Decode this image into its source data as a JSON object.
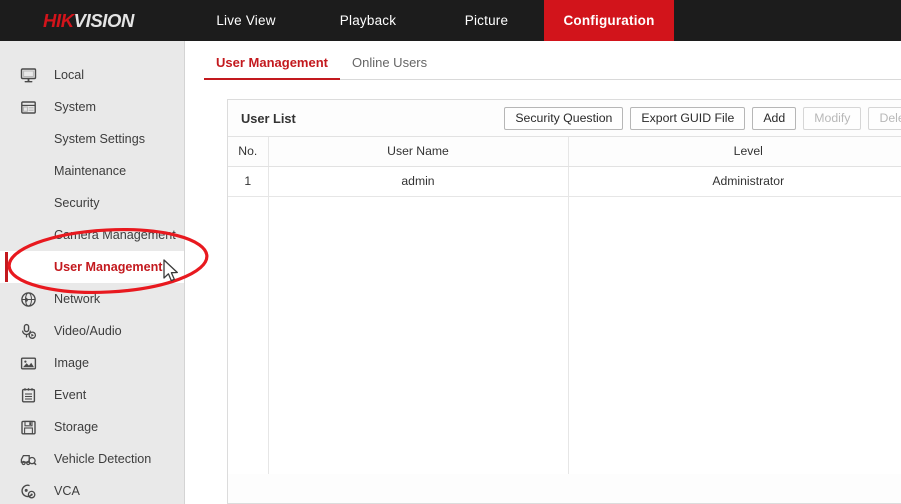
{
  "brand": {
    "name_part1": "HIK",
    "name_part2": "VISION",
    "accent": "#d2141b"
  },
  "topnav": {
    "items": [
      {
        "label": "Live View",
        "active": false
      },
      {
        "label": "Playback",
        "active": false
      },
      {
        "label": "Picture",
        "active": false
      },
      {
        "label": "Configuration",
        "active": true
      }
    ]
  },
  "sidebar": {
    "items": [
      {
        "label": "Local",
        "icon": "monitor-icon",
        "type": "parent",
        "selected": false
      },
      {
        "label": "System",
        "icon": "system-icon",
        "type": "parent",
        "selected": false
      },
      {
        "label": "System Settings",
        "icon": "",
        "type": "child",
        "selected": false
      },
      {
        "label": "Maintenance",
        "icon": "",
        "type": "child",
        "selected": false
      },
      {
        "label": "Security",
        "icon": "",
        "type": "child",
        "selected": false
      },
      {
        "label": "Camera Management",
        "icon": "",
        "type": "child",
        "selected": false
      },
      {
        "label": "User Management",
        "icon": "",
        "type": "child",
        "selected": true
      },
      {
        "label": "Network",
        "icon": "globe-icon",
        "type": "parent",
        "selected": false
      },
      {
        "label": "Video/Audio",
        "icon": "microphone-icon",
        "type": "parent",
        "selected": false
      },
      {
        "label": "Image",
        "icon": "picture-icon",
        "type": "parent",
        "selected": false
      },
      {
        "label": "Event",
        "icon": "clipboard-icon",
        "type": "parent",
        "selected": false
      },
      {
        "label": "Storage",
        "icon": "floppy-disk-icon",
        "type": "parent",
        "selected": false
      },
      {
        "label": "Vehicle Detection",
        "icon": "vehicle-search-icon",
        "type": "parent",
        "selected": false
      },
      {
        "label": "VCA",
        "icon": "vca-icon",
        "type": "parent",
        "selected": false
      }
    ]
  },
  "content": {
    "tabs": [
      {
        "label": "User Management",
        "active": true
      },
      {
        "label": "Online Users",
        "active": false
      }
    ],
    "panel": {
      "title": "User List",
      "buttons": [
        {
          "label": "Security Question",
          "disabled": false
        },
        {
          "label": "Export GUID File",
          "disabled": false
        },
        {
          "label": "Add",
          "disabled": false
        },
        {
          "label": "Modify",
          "disabled": true
        },
        {
          "label": "Delete",
          "disabled": true
        }
      ],
      "table": {
        "columns": [
          "No.",
          "User Name",
          "Level"
        ],
        "rows": [
          {
            "no": "1",
            "user_name": "admin",
            "level": "Administrator"
          }
        ]
      }
    }
  },
  "annotation": {
    "ellipse_color": "#e8191f",
    "target_label": "User Management"
  }
}
